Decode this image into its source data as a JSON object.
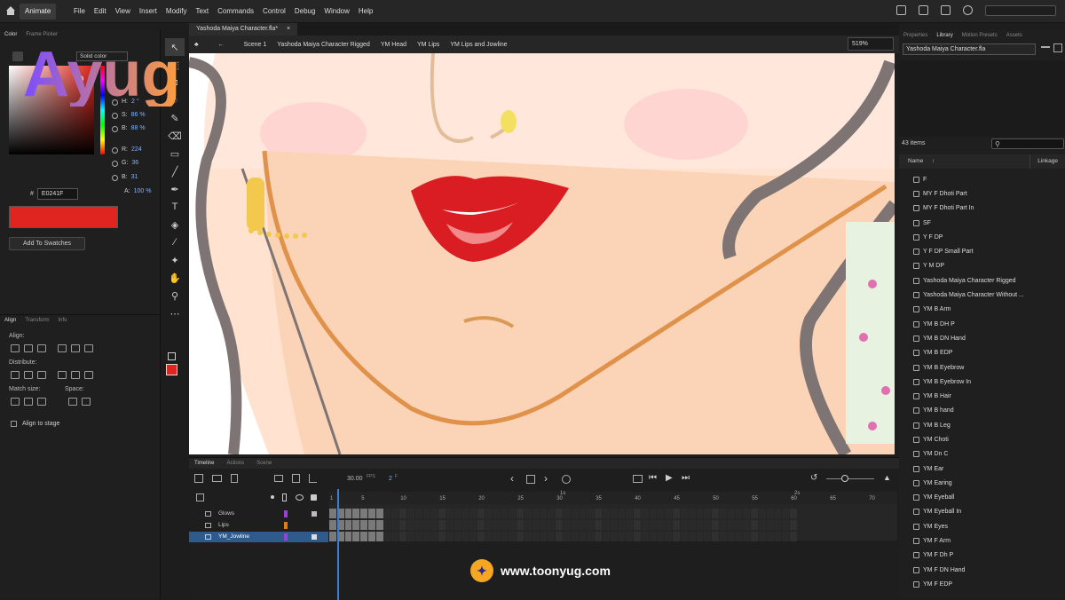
{
  "menubar": {
    "workspace": "Animate",
    "menus": [
      "File",
      "Edit",
      "View",
      "Insert",
      "Modify",
      "Text",
      "Commands",
      "Control",
      "Debug",
      "Window",
      "Help"
    ]
  },
  "color_panel": {
    "tabs": [
      "Color",
      "Frame Picker"
    ],
    "fill_type": "Solid color",
    "H": {
      "label": "H:",
      "value": "2 °"
    },
    "S": {
      "label": "S:",
      "value": "86 %"
    },
    "B": {
      "label": "B:",
      "value": "88 %"
    },
    "R": {
      "label": "R:",
      "value": "224"
    },
    "G": {
      "label": "G:",
      "value": "36"
    },
    "Bl": {
      "label": "B:",
      "value": "31"
    },
    "A": {
      "label": "A:",
      "value": "100 %"
    },
    "hex_label": "#",
    "hex": "E0241F",
    "swatch_color": "#e0241f",
    "add_to_swatches": "Add To Swatches"
  },
  "align_panel": {
    "tabs": [
      "Align",
      "Transform",
      "Info"
    ],
    "align": "Align:",
    "distribute": "Distribute:",
    "match_size": "Match size:",
    "space": "Space:",
    "align_to_stage": "Align to stage"
  },
  "logo": {
    "text": "Ayug"
  },
  "document": {
    "tab": "Yashoda Maiya Character.fla*",
    "close": "×"
  },
  "editbar": {
    "scene": "Scene 1",
    "crumbs": [
      "Yashoda Maiya Character Rigged",
      "YM Head",
      "YM Lips",
      "YM Lips and Jowline"
    ],
    "zoom": "519%"
  },
  "library": {
    "tabs": [
      "Properties",
      "Library",
      "Motion Presets",
      "Assets"
    ],
    "file": "Yashoda Maiya Character.fla",
    "items_count": "43 items",
    "col_name": "Name",
    "col_linkage": "Linkage",
    "items": [
      "F",
      "MY F Dhoti Part",
      "MY F Dhoti Part In",
      "SF",
      "Y F DP",
      "Y F DP Small Part",
      "Y M DP",
      "Yashoda Maiya Character Rigged",
      "Yashoda Maiya Character Without ...",
      "YM B Arm",
      "YM B DH P",
      "YM B DN Hand",
      "YM B EDP",
      "YM B Eyebrow",
      "YM B Eyebrow In",
      "YM B Hair",
      "YM B hand",
      "YM B Leg",
      "YM Choti",
      "YM Dn C",
      "YM Ear",
      "YM Earing",
      "YM Eyeball",
      "YM Eyeball In",
      "YM Eyes",
      "YM F Arm",
      "YM F Dh P",
      "YM F DN Hand",
      "YM F EDP"
    ]
  },
  "timeline": {
    "tabs": [
      "Timeline",
      "Actions",
      "Scene"
    ],
    "fps": "30.00",
    "fps_label": "FPS",
    "frame": "2",
    "frame_label": "F",
    "ruler_marks": [
      "1",
      "5",
      "10",
      "15",
      "20",
      "25",
      "30",
      "35",
      "40",
      "45",
      "50",
      "55",
      "60",
      "65",
      "70"
    ],
    "sec_marks": [
      "1s",
      "2s"
    ],
    "layers": [
      {
        "name": "Glows",
        "color": "#9a40d8"
      },
      {
        "name": "Lips",
        "color": "#e07a1a"
      },
      {
        "name": "YM_Jowline",
        "color": "#9a40d8"
      }
    ]
  },
  "watermark_url": "www.toonyug.com"
}
